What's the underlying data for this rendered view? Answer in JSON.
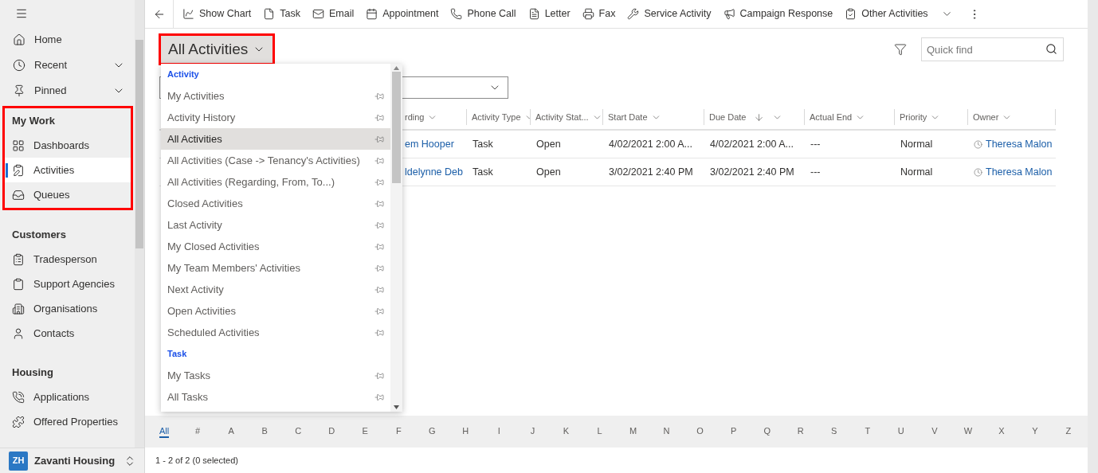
{
  "sidebar": {
    "top_items": [
      {
        "label": "Home",
        "expandable": false
      },
      {
        "label": "Recent",
        "expandable": true
      },
      {
        "label": "Pinned",
        "expandable": true
      }
    ],
    "groups": [
      {
        "title": "My Work",
        "highlighted": true,
        "items": [
          {
            "label": "Dashboards",
            "selected": false
          },
          {
            "label": "Activities",
            "selected": true
          },
          {
            "label": "Queues",
            "selected": false
          }
        ]
      },
      {
        "title": "Customers",
        "highlighted": false,
        "items": [
          {
            "label": "Tradesperson",
            "selected": false
          },
          {
            "label": "Support Agencies",
            "selected": false
          },
          {
            "label": "Organisations",
            "selected": false
          },
          {
            "label": "Contacts",
            "selected": false
          }
        ]
      },
      {
        "title": "Housing",
        "highlighted": false,
        "items": [
          {
            "label": "Applications",
            "selected": false
          },
          {
            "label": "Offered Properties",
            "selected": false
          }
        ]
      }
    ],
    "footer": {
      "initials": "ZH",
      "name": "Zavanti Housing"
    }
  },
  "toolbar": {
    "items": [
      {
        "label": "Show Chart",
        "has_menu": false
      },
      {
        "label": "Task",
        "has_menu": false
      },
      {
        "label": "Email",
        "has_menu": false
      },
      {
        "label": "Appointment",
        "has_menu": false
      },
      {
        "label": "Phone Call",
        "has_menu": false
      },
      {
        "label": "Letter",
        "has_menu": false
      },
      {
        "label": "Fax",
        "has_menu": false
      },
      {
        "label": "Service Activity",
        "has_menu": false
      },
      {
        "label": "Campaign Response",
        "has_menu": false
      },
      {
        "label": "Other Activities",
        "has_menu": true
      }
    ]
  },
  "view": {
    "title": "All Activities",
    "highlighted": true,
    "quick_find": {
      "placeholder": "Quick find"
    }
  },
  "view_menu": {
    "sections": [
      {
        "title": "Activity",
        "items": [
          {
            "label": "My Activities",
            "selected": false
          },
          {
            "label": "Activity History",
            "selected": false
          },
          {
            "label": "All Activities",
            "selected": true
          },
          {
            "label": "All Activities (Case -> Tenancy's Activities)",
            "selected": false
          },
          {
            "label": "All Activities (Regarding, From, To...)",
            "selected": false
          },
          {
            "label": "Closed Activities",
            "selected": false
          },
          {
            "label": "Last Activity",
            "selected": false
          },
          {
            "label": "My Closed Activities",
            "selected": false
          },
          {
            "label": "My Team Members' Activities",
            "selected": false
          },
          {
            "label": "Next Activity",
            "selected": false
          },
          {
            "label": "Open Activities",
            "selected": false
          },
          {
            "label": "Scheduled Activities",
            "selected": false
          }
        ]
      },
      {
        "title": "Task",
        "items": [
          {
            "label": "My Tasks",
            "selected": false
          },
          {
            "label": "All Tasks",
            "selected": false
          }
        ]
      }
    ]
  },
  "table": {
    "columns": [
      {
        "label": "rding",
        "kind": "link",
        "sorted": false
      },
      {
        "label": "Activity Type",
        "kind": "text",
        "sorted": false
      },
      {
        "label": "Activity Stat...",
        "kind": "text",
        "sorted": false
      },
      {
        "label": "Start Date",
        "kind": "text",
        "sorted": false
      },
      {
        "label": "Due Date",
        "kind": "text",
        "sorted": true
      },
      {
        "label": "Actual End",
        "kind": "text",
        "sorted": false
      },
      {
        "label": "Priority",
        "kind": "text",
        "sorted": false
      },
      {
        "label": "Owner",
        "kind": "owner",
        "sorted": false
      }
    ],
    "rows": [
      {
        "cells": [
          "em Hooper",
          "Task",
          "Open",
          "4/02/2021 2:00 A...",
          "4/02/2021 2:00 A...",
          "---",
          "Normal",
          "Theresa Malon"
        ]
      },
      {
        "cells": [
          "ldelynne Deb",
          "Task",
          "Open",
          "3/02/2021 2:40 PM",
          "3/02/2021 2:40 PM",
          "---",
          "Normal",
          "Theresa Malon"
        ]
      }
    ]
  },
  "alphabet": [
    {
      "label": "All",
      "selected": true
    },
    {
      "label": "#",
      "selected": false
    },
    {
      "label": "A",
      "selected": false
    },
    {
      "label": "B",
      "selected": false
    },
    {
      "label": "C",
      "selected": false
    },
    {
      "label": "D",
      "selected": false
    },
    {
      "label": "E",
      "selected": false
    },
    {
      "label": "F",
      "selected": false
    },
    {
      "label": "G",
      "selected": false
    },
    {
      "label": "H",
      "selected": false
    },
    {
      "label": "I",
      "selected": false
    },
    {
      "label": "J",
      "selected": false
    },
    {
      "label": "K",
      "selected": false
    },
    {
      "label": "L",
      "selected": false
    },
    {
      "label": "M",
      "selected": false
    },
    {
      "label": "N",
      "selected": false
    },
    {
      "label": "O",
      "selected": false
    },
    {
      "label": "P",
      "selected": false
    },
    {
      "label": "Q",
      "selected": false
    },
    {
      "label": "R",
      "selected": false
    },
    {
      "label": "S",
      "selected": false
    },
    {
      "label": "T",
      "selected": false
    },
    {
      "label": "U",
      "selected": false
    },
    {
      "label": "V",
      "selected": false
    },
    {
      "label": "W",
      "selected": false
    },
    {
      "label": "X",
      "selected": false
    },
    {
      "label": "Y",
      "selected": false
    },
    {
      "label": "Z",
      "selected": false
    }
  ],
  "status_bar": "1 - 2 of 2 (0 selected)"
}
